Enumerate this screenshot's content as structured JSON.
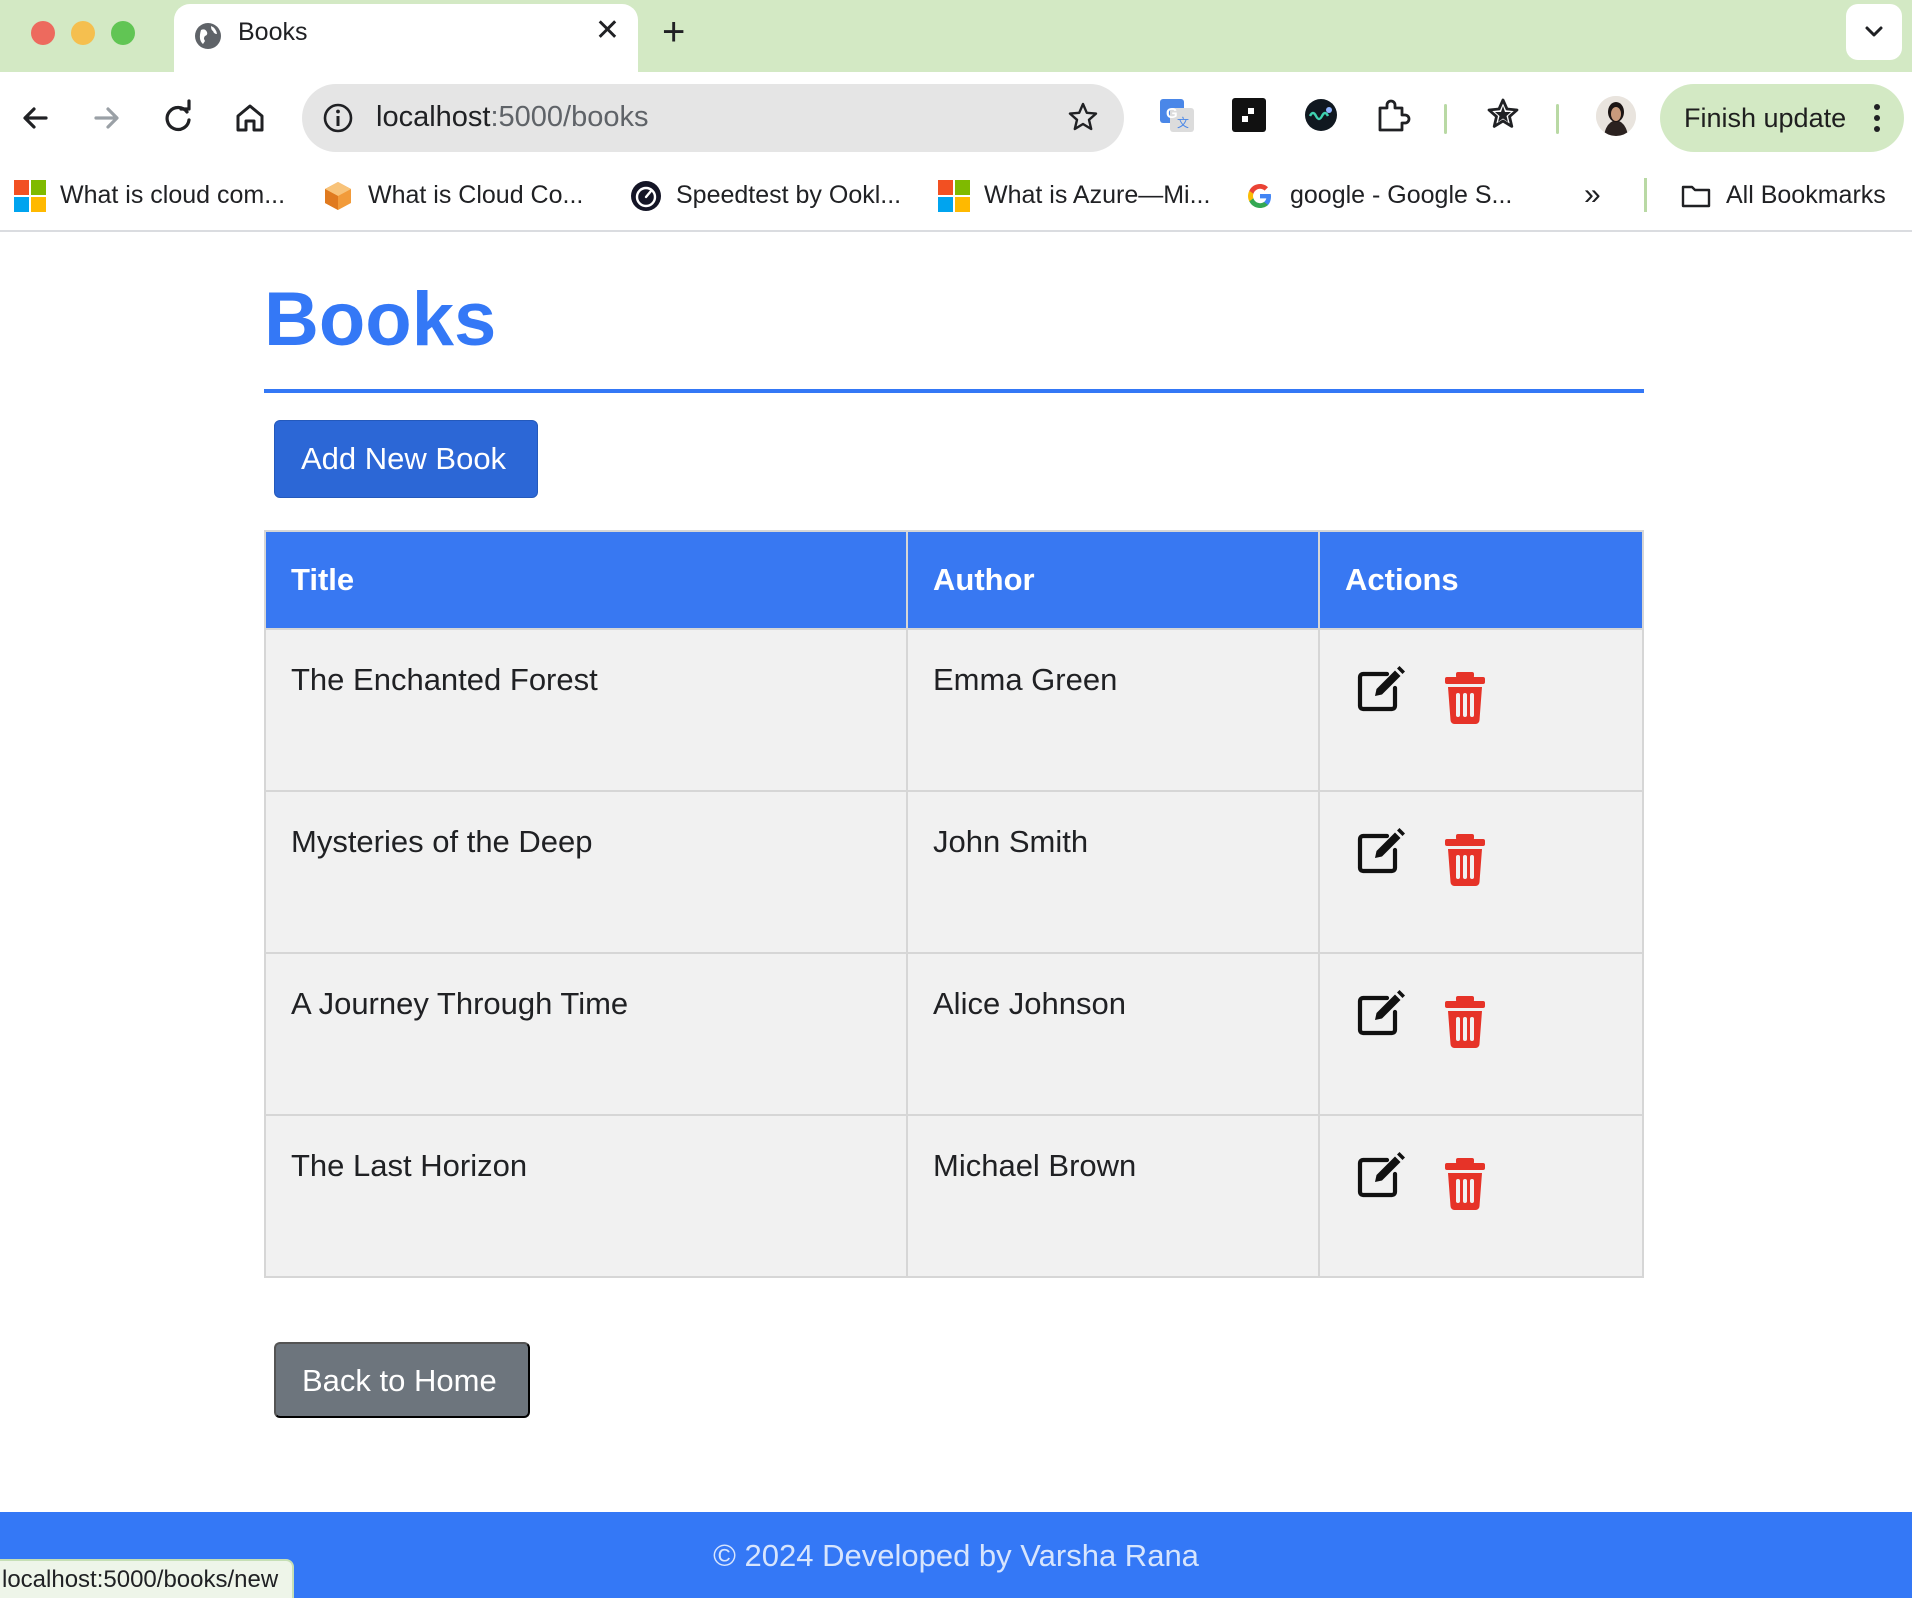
{
  "browser": {
    "tab": {
      "title": "Books",
      "close_glyph": "✕",
      "favicon": "globe-icon"
    },
    "new_tab_glyph": "+",
    "address": {
      "host": "localhost",
      "rest": ":5000/books"
    },
    "finish_update_label": "Finish update",
    "bookmarks": [
      {
        "label": "What is cloud com...",
        "icon": "microsoft-icon"
      },
      {
        "label": "What is Cloud Co...",
        "icon": "aws-cube-icon"
      },
      {
        "label": "Speedtest by Ookl...",
        "icon": "speedtest-icon"
      },
      {
        "label": "What is Azure—Mi...",
        "icon": "microsoft-icon"
      },
      {
        "label": "google - Google S...",
        "icon": "google-icon"
      }
    ],
    "bookmarks_more_glyph": "»",
    "all_bookmarks_label": "All Bookmarks",
    "status_url": "localhost:5000/books/new"
  },
  "page": {
    "title": "Books",
    "add_button_label": "Add New Book",
    "table": {
      "headers": {
        "title": "Title",
        "author": "Author",
        "actions": "Actions"
      },
      "rows": [
        {
          "title": "The Enchanted Forest",
          "author": "Emma Green"
        },
        {
          "title": "Mysteries of the Deep",
          "author": "John Smith"
        },
        {
          "title": "A Journey Through Time",
          "author": "Alice Johnson"
        },
        {
          "title": "The Last Horizon",
          "author": "Michael Brown"
        }
      ]
    },
    "back_button_label": "Back to Home",
    "footer_text": "© 2024 Developed by Varsha Rana"
  },
  "colors": {
    "accent_blue": "#3478f6",
    "add_button": "#2c67d6",
    "back_button": "#6d757d",
    "delete_red": "#e63328",
    "chrome_green": "#d3e9c4"
  }
}
